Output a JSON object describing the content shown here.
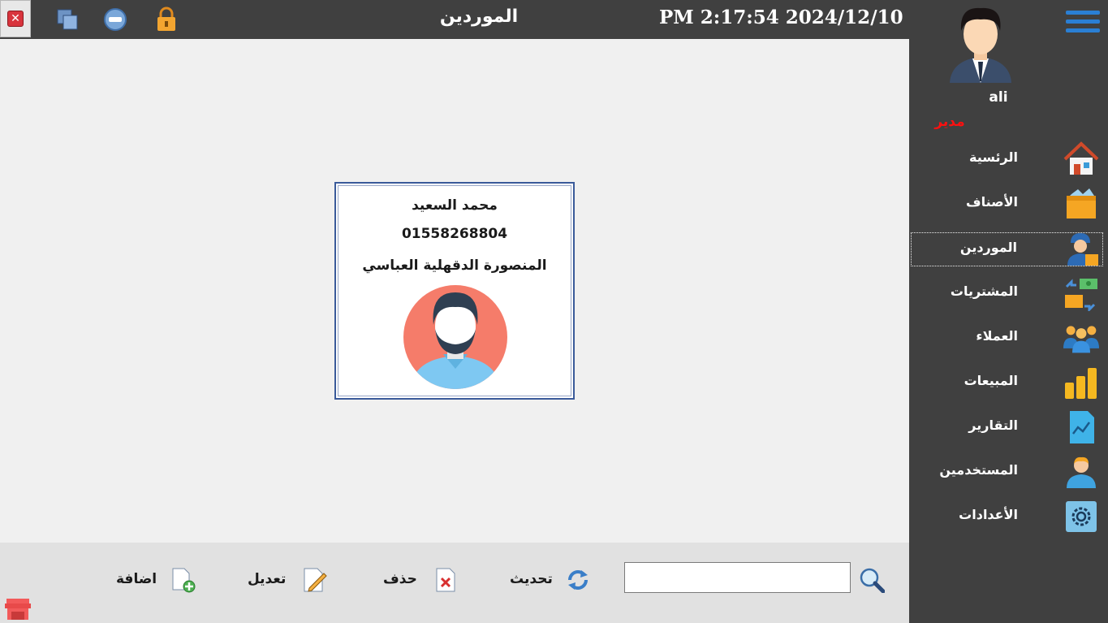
{
  "window": {
    "title": "الموردين",
    "clock": "PM 2:17:54 2024/12/10",
    "controls": {
      "close": "close-icon",
      "restore": "restore-icon",
      "minimize": "minimize-icon",
      "lock": "lock-icon"
    }
  },
  "user": {
    "name": "ali",
    "role": "مدير"
  },
  "sidebar": {
    "items": [
      {
        "label": "الرئسية",
        "icon": "home-icon"
      },
      {
        "label": "الأصناف",
        "icon": "box-icon"
      },
      {
        "label": "الموردين",
        "icon": "supplier-icon",
        "active": true
      },
      {
        "label": "المشتريات",
        "icon": "purchases-icon"
      },
      {
        "label": "العملاء",
        "icon": "customers-icon"
      },
      {
        "label": "المبيعات",
        "icon": "coins-icon"
      },
      {
        "label": "التقارير",
        "icon": "report-icon"
      },
      {
        "label": "المستخدمين",
        "icon": "user-icon"
      },
      {
        "label": "الأعدادات",
        "icon": "settings-icon"
      }
    ]
  },
  "supplier_card": {
    "name": "محمد السعيد",
    "phone": "01558268804",
    "address": "المنصورة الدقهلية العباسي"
  },
  "toolbar": {
    "search": {
      "value": "",
      "placeholder": ""
    },
    "refresh_label": "تحديث",
    "delete_label": "حذف",
    "edit_label": "تعديل",
    "add_label": "اضافة"
  }
}
